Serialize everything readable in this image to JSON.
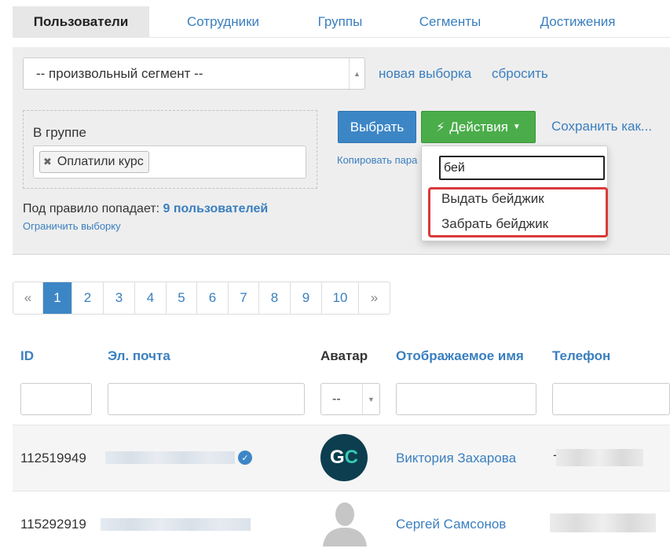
{
  "tabs": [
    {
      "label": "Пользователи",
      "active": true
    },
    {
      "label": "Сотрудники"
    },
    {
      "label": "Группы"
    },
    {
      "label": "Сегменты"
    },
    {
      "label": "Достижения"
    }
  ],
  "filter": {
    "segment_value": "-- произвольный сегмент --",
    "new_selection_link": "новая выборка",
    "reset_link": "сбросить",
    "rule_label": "В группе",
    "rule_tag": "Оплатили курс",
    "select_button": "Выбрать",
    "actions_button": "Действия",
    "save_link": "Сохранить как...",
    "copy_link": "Копировать пара",
    "count_prefix": "Под правило попадает:",
    "count_value": "9 пользователей",
    "limit_link": "Ограничить выборку"
  },
  "actions_dropdown": {
    "search_value": "бей",
    "items": [
      "Выдать бейджик",
      "Забрать бейджик"
    ]
  },
  "pagination": {
    "prev": "«",
    "pages": [
      "1",
      "2",
      "3",
      "4",
      "5",
      "6",
      "7",
      "8",
      "9",
      "10"
    ],
    "active_page": "1",
    "next": "»"
  },
  "table": {
    "columns": [
      "ID",
      "Эл. почта",
      "Аватар",
      "Отображаемое имя",
      "Телефон"
    ],
    "avatar_filter_value": "--",
    "rows": [
      {
        "id": "112519949",
        "name": "Виктория Захарова",
        "avatar": "GC",
        "phone_prefix": "-"
      },
      {
        "id": "115292919",
        "name": "Сергей Самсонов",
        "avatar": "default-user-icon"
      }
    ]
  },
  "colors": {
    "link": "#3a7fbf",
    "primary_button": "#3d86c6",
    "success_button": "#4aad4a",
    "highlight_border": "#d93a3a",
    "panel_bg": "#eeeeee"
  }
}
